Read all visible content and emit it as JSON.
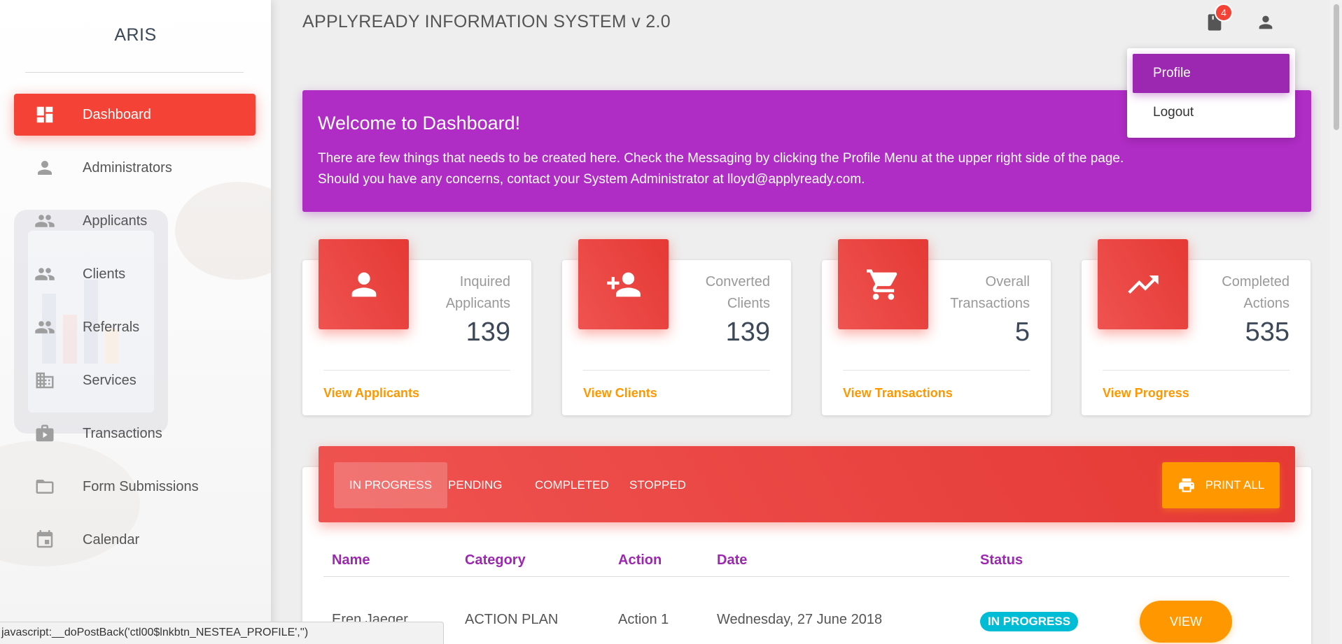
{
  "sidebar": {
    "brand": "ARIS",
    "items": [
      {
        "label": "Dashboard",
        "icon": "dashboard-icon",
        "active": true
      },
      {
        "label": "Administrators",
        "icon": "person-icon"
      },
      {
        "label": "Applicants",
        "icon": "people-icon"
      },
      {
        "label": "Clients",
        "icon": "people-icon"
      },
      {
        "label": "Referrals",
        "icon": "people-icon"
      },
      {
        "label": "Services",
        "icon": "building-icon"
      },
      {
        "label": "Transactions",
        "icon": "work-icon"
      },
      {
        "label": "Form Submissions",
        "icon": "folder-icon"
      },
      {
        "label": "Calendar",
        "icon": "calendar-icon"
      }
    ]
  },
  "header": {
    "title": "APPLYREADY INFORMATION SYSTEM v 2.0",
    "notification_count": "4"
  },
  "profile_menu": {
    "items": [
      "Profile",
      "Logout"
    ]
  },
  "welcome": {
    "title": "Welcome to Dashboard!",
    "line1": "There are few things that needs to be created here. Check the Messaging by clicking the Profile Menu at the upper right side of the page.",
    "line2": "Should you have any concerns, contact your System Administrator at lloyd@applyready.com."
  },
  "stats": [
    {
      "category_line1": "Inquired",
      "category_line2": "Applicants",
      "value": "139",
      "link": "View Applicants",
      "icon": "person-icon"
    },
    {
      "category_line1": "Converted",
      "category_line2": "Clients",
      "value": "139",
      "link": "View Clients",
      "icon": "person-add-icon"
    },
    {
      "category_line1": "Overall",
      "category_line2": "Transactions",
      "value": "5",
      "link": "View Transactions",
      "icon": "cart-icon"
    },
    {
      "category_line1": "Completed",
      "category_line2": "Actions",
      "value": "535",
      "link": "View Progress",
      "icon": "trending-up-icon"
    }
  ],
  "tabs": [
    "IN PROGRESS",
    "PENDING",
    "COMPLETED",
    "STOPPED"
  ],
  "print_button": "PRINT ALL",
  "table": {
    "columns": [
      "Name",
      "Category",
      "Action",
      "Date",
      "Status"
    ],
    "rows": [
      {
        "name": "Eren Jaeger",
        "category": "ACTION PLAN",
        "action": "Action 1",
        "date": "Wednesday, 27 June 2018",
        "status": "IN PROGRESS",
        "button": "VIEW"
      }
    ]
  },
  "statusbar": "javascript:__doPostBack('ctl00$lnkbtn_NESTEA_PROFILE','')",
  "colors": {
    "accent_red": "#f44336",
    "purple": "#9c27b0",
    "orange": "#ff9800",
    "cyan": "#00bcd4"
  }
}
